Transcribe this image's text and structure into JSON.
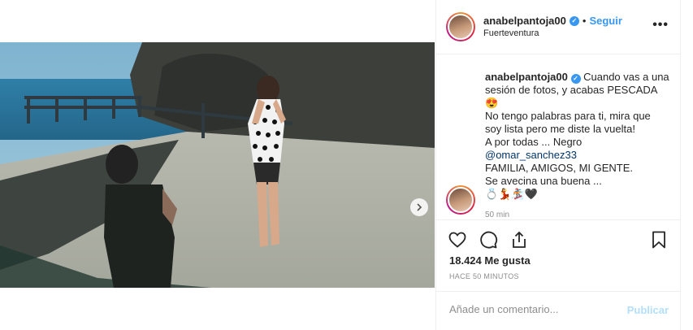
{
  "post": {
    "username": "anabelpantoja00",
    "separator": "•",
    "follow_label": "Seguir",
    "location": "Fuerteventura",
    "more_label": "•••"
  },
  "caption": {
    "lines": [
      "Cuando vas a una",
      "sesión de fotos, y acabas PESCADA",
      "😍",
      "No tengo palabras para ti, mira que",
      "soy lista pero me diste la vuelta!",
      "A por todas ... Negro",
      "@omar_sanchez33",
      "FAMILIA, AMIGOS, MI GENTE.",
      "Se avecina una buena ...",
      "💍💃🏂🖤"
    ],
    "time": "50 min"
  },
  "actions": {
    "likes": "18.424 Me gusta",
    "time_ago": "HACE 50 MINUTOS"
  },
  "comment": {
    "placeholder": "Añade un comentario...",
    "publish_label": "Publicar"
  },
  "colors": {
    "accent": "#3897f0",
    "publish_disabled": "#b2dffc",
    "mention": "#003569"
  },
  "carousel": {
    "slides": 2,
    "active_index": 0
  }
}
